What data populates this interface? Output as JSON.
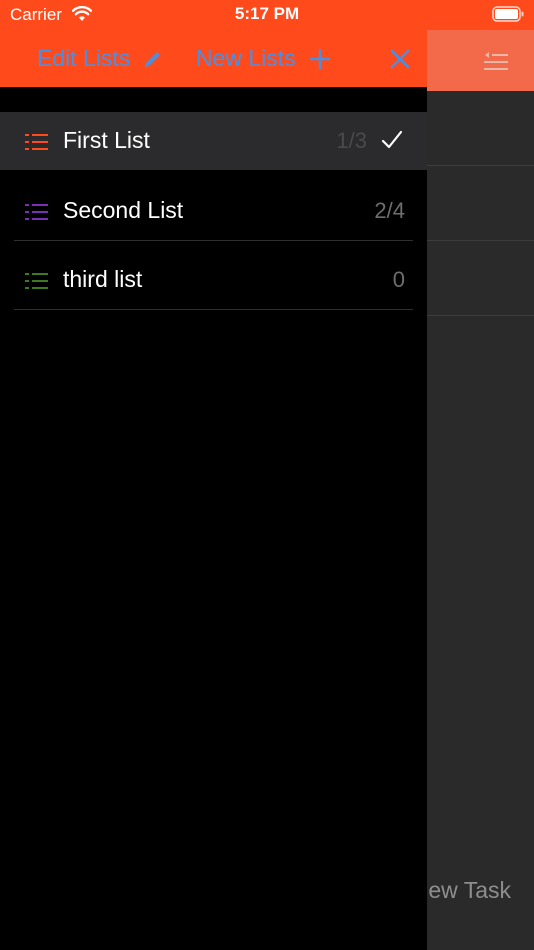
{
  "status_bar": {
    "carrier": "Carrier",
    "time": "5:17 PM"
  },
  "header": {
    "edit_lists_label": "Edit Lists",
    "new_lists_label": "New Lists"
  },
  "lists": [
    {
      "name": "First List",
      "count": "1/3",
      "selected": true,
      "icon_color": "#ff4a1c"
    },
    {
      "name": "Second List",
      "count": "2/4",
      "selected": false,
      "icon_color": "#7a2fb5"
    },
    {
      "name": "third list",
      "count": "0",
      "selected": false,
      "icon_color": "#3f7a1e"
    }
  ],
  "background": {
    "new_task_label": "ew Task"
  },
  "colors": {
    "accent_orange": "#ff4a1c",
    "link_blue": "#4a90e2",
    "drawer_bg": "#000000",
    "selected_row_bg": "#2b2b2d"
  },
  "icons": [
    "wifi-icon",
    "battery-icon",
    "pencil-icon",
    "plus-icon",
    "close-icon",
    "list-icon",
    "checkmark-icon",
    "menu-icon"
  ]
}
